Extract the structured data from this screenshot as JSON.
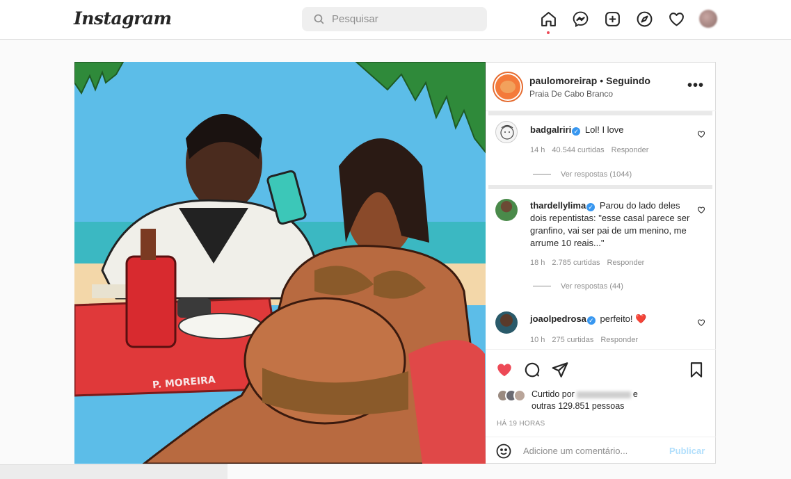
{
  "brand": {
    "logo": "Instagram"
  },
  "search": {
    "placeholder": "Pesquisar"
  },
  "nav": [
    "home-icon",
    "messenger-icon",
    "new-post-icon",
    "explore-icon",
    "activity-heart-icon",
    "profile-avatar"
  ],
  "post": {
    "username": "paulomoreirap",
    "following_label": "Seguindo",
    "location": "Praia De Cabo Branco",
    "more": "•••",
    "image_signature": "P. MOREIRA"
  },
  "comments": [
    {
      "user": "badgalriri",
      "verified": true,
      "text": "Lol! I love",
      "time": "14 h",
      "likes": "40.544 curtidas",
      "reply": "Responder",
      "replies": "Ver respostas (1044)"
    },
    {
      "user": "thardellylima",
      "verified": true,
      "text": "Parou do lado deles dois repentistas: \"esse casal parece ser granfino, vai ser pai de um menino, me arrume 10 reais...\"",
      "time": "18 h",
      "likes": "2.785 curtidas",
      "reply": "Responder",
      "replies": "Ver respostas (44)"
    },
    {
      "user": "joaolpedrosa",
      "verified": true,
      "text": "perfeito!",
      "emoji": "❤️",
      "time": "10 h",
      "likes": "275 curtidas",
      "reply": "Responder"
    }
  ],
  "likes": {
    "prefix": "Curtido por",
    "suffix": "e",
    "others": "outras 129.851 pessoas"
  },
  "time_ago": "HÁ 19 HORAS",
  "add_comment": {
    "placeholder": "Adicione um comentário...",
    "publish": "Publicar"
  },
  "colors": {
    "like_red": "#ed4956",
    "verified_blue": "#3897f0",
    "publish_disabled": "#b2dffc"
  }
}
